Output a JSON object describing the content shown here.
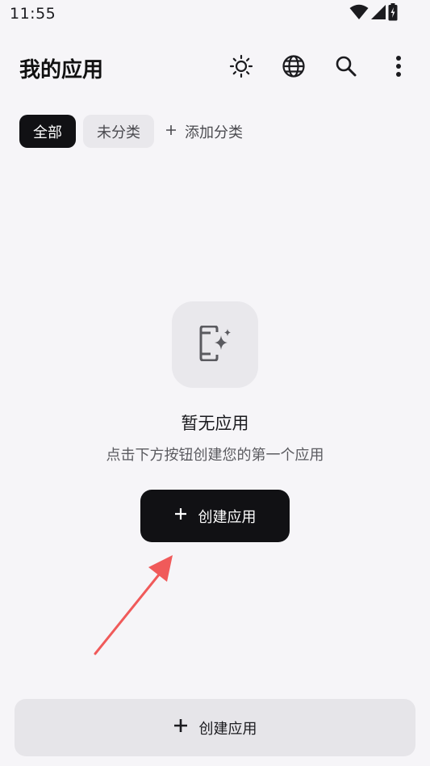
{
  "status_bar": {
    "time": "11:55",
    "icons": [
      "wifi-icon",
      "signal-icon",
      "battery-charging-icon"
    ]
  },
  "app_bar": {
    "title": "我的应用",
    "actions": [
      "theme-brightness-icon",
      "language-globe-icon",
      "search-icon",
      "more-vert-icon"
    ]
  },
  "filters": {
    "chips": [
      {
        "label": "全部",
        "selected": true
      },
      {
        "label": "未分类",
        "selected": false
      }
    ],
    "add_label": "添加分类"
  },
  "empty_state": {
    "icon": "phone-sparkle-icon",
    "title": "暂无应用",
    "subtitle": "点击下方按钮创建您的第一个应用",
    "button_label": "创建应用"
  },
  "annotation": {
    "icon": "pointer-arrow",
    "color": "#f05a5a"
  },
  "bottom_bar": {
    "button_label": "创建应用"
  },
  "colors": {
    "background": "#f6f5f8",
    "primary_dark": "#111114",
    "chip_light": "#e9e8ec",
    "bottom_button": "#e6e5e9",
    "annotation_red": "#f05a5a"
  }
}
